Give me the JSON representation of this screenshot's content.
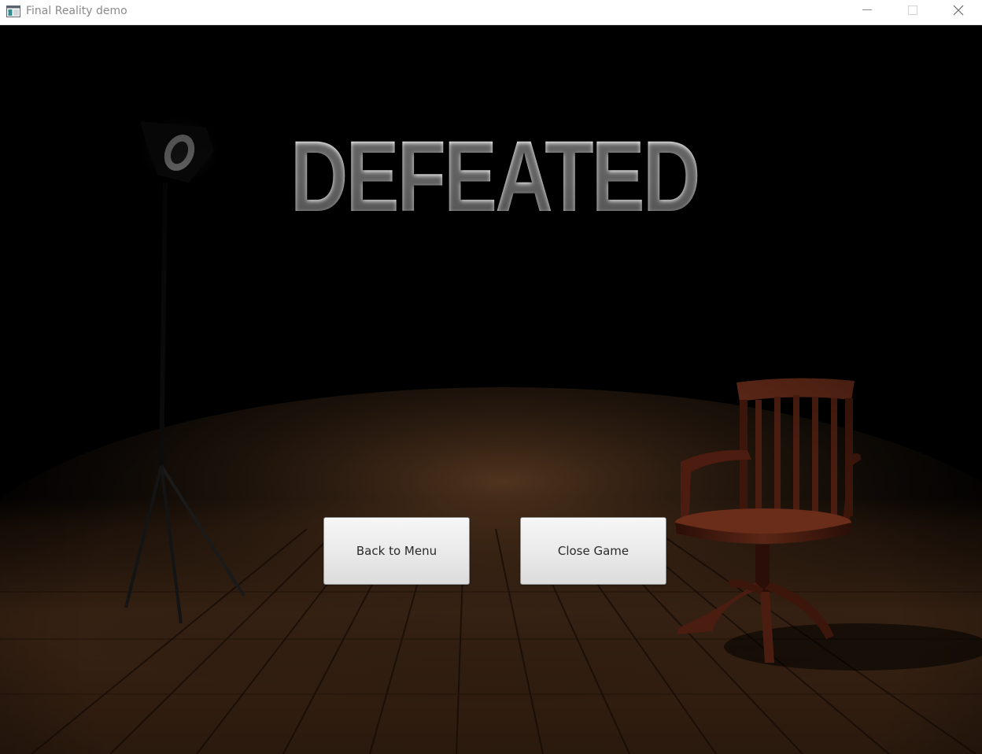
{
  "window": {
    "title": "Final Reality demo",
    "icon": "app-window-icon",
    "controls": [
      "minimize-icon",
      "maximize-icon",
      "close-icon"
    ]
  },
  "scene": {
    "headline": "DEFEATED",
    "background": "dark stage with spotlight lamp and wooden chair on plank floor",
    "buttons": {
      "back_to_menu": "Back to Menu",
      "close_game": "Close Game"
    }
  },
  "colors": {
    "background": "#000000",
    "headline": "#ededed",
    "button_face": "#e9e9e9",
    "button_text": "#2a2a2a",
    "floor": "#3a2414",
    "chair": "#4a1f12"
  }
}
